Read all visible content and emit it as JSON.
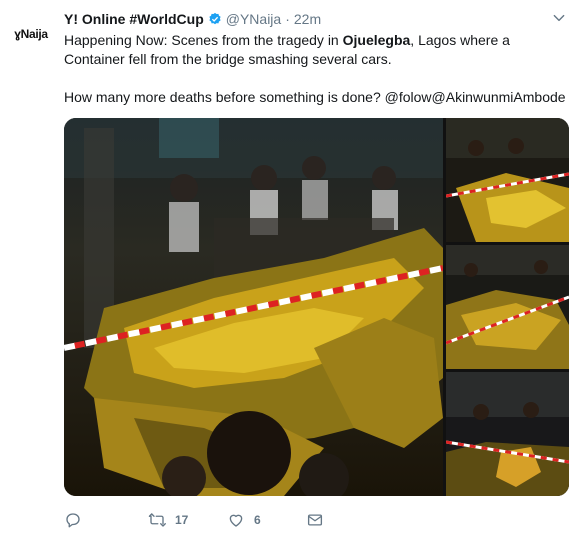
{
  "account": {
    "avatar_text": "ɣNaija",
    "display_name": "Y! Online #WorldCup",
    "handle": "@YNaija",
    "separator": "·",
    "time": "22m",
    "verified": true
  },
  "tweet": {
    "text_prefix": "Happening Now: Scenes from the tragedy in ",
    "text_bold": "Ojuelegba",
    "text_suffix": ", Lagos where a Container fell from the bridge smashing several cars.",
    "text_second": "How many more deaths before something is done? @folow@AkinwunmiAmbode"
  },
  "media": {
    "photos": [
      "crash-photo-main",
      "crash-photo-2",
      "crash-photo-3",
      "crash-photo-4"
    ]
  },
  "actions": {
    "reply_icon": "reply-icon",
    "retweet_icon": "retweet-icon",
    "retweet_count": "17",
    "like_icon": "heart-icon",
    "like_count": "6",
    "dm_icon": "envelope-icon"
  },
  "colors": {
    "text": "#14171a",
    "secondary": "#657786",
    "verified": "#1da1f2",
    "taxi_yellow": "#c9a21a"
  }
}
